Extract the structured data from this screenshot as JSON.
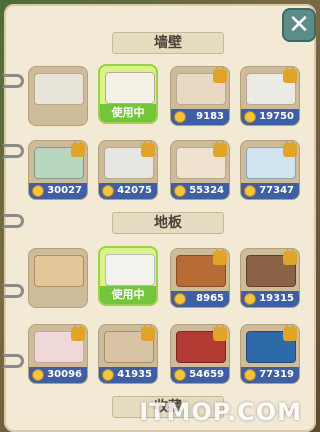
{
  "window": {
    "close_label": "✕"
  },
  "sections": {
    "wall": {
      "title": "墙壁"
    },
    "floor": {
      "title": "地板"
    },
    "third": {
      "title": "收藏"
    }
  },
  "wall_items": [
    {
      "name": "wall-1",
      "state": "owned"
    },
    {
      "name": "wall-2",
      "state": "active",
      "label": "使用中"
    },
    {
      "name": "wall-3",
      "state": "locked",
      "price": "9183"
    },
    {
      "name": "wall-4",
      "state": "locked",
      "price": "19750"
    },
    {
      "name": "wall-5",
      "state": "locked",
      "price": "30027"
    },
    {
      "name": "wall-6",
      "state": "locked",
      "price": "42075"
    },
    {
      "name": "wall-7",
      "state": "locked",
      "price": "55324"
    },
    {
      "name": "wall-8",
      "state": "locked",
      "price": "77347"
    }
  ],
  "floor_items": [
    {
      "name": "floor-1",
      "state": "owned"
    },
    {
      "name": "floor-2",
      "state": "active",
      "label": "使用中"
    },
    {
      "name": "floor-3",
      "state": "locked",
      "price": "8965"
    },
    {
      "name": "floor-4",
      "state": "locked",
      "price": "19315"
    },
    {
      "name": "floor-5",
      "state": "locked",
      "price": "30096"
    },
    {
      "name": "floor-6",
      "state": "locked",
      "price": "41935"
    },
    {
      "name": "floor-7",
      "state": "locked",
      "price": "54659"
    },
    {
      "name": "floor-8",
      "state": "locked",
      "price": "77319"
    }
  ],
  "watermark": "ITMOP.COM",
  "colors": {
    "price_bar": "#3f5fa4",
    "active_bg": "#d9f38b",
    "active_label": "#74c43c",
    "coin": "#f2c440",
    "close_btn": "#5c8c87"
  }
}
